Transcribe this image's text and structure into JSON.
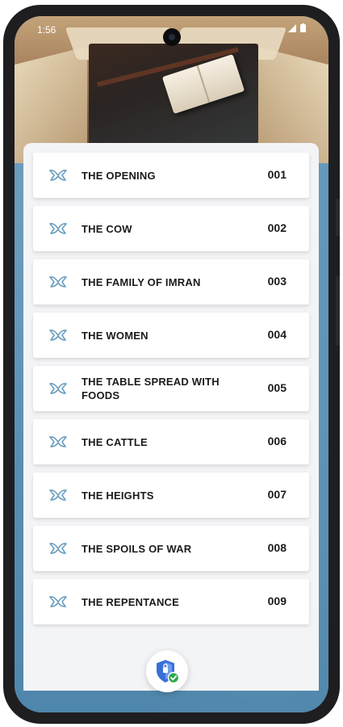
{
  "status_bar": {
    "time": "1:56",
    "icons": [
      "signal-icon",
      "battery-icon"
    ]
  },
  "chapters": [
    {
      "title": "THE OPENING",
      "number": "001"
    },
    {
      "title": "THE COW",
      "number": "002"
    },
    {
      "title": "THE FAMILY OF IMRAN",
      "number": "003"
    },
    {
      "title": "THE WOMEN",
      "number": "004"
    },
    {
      "title": "THE TABLE SPREAD WITH FOODS",
      "number": "005"
    },
    {
      "title": "THE CATTLE",
      "number": "006"
    },
    {
      "title": "THE HEIGHTS",
      "number": "007"
    },
    {
      "title": "THE SPOILS OF WAR",
      "number": "008"
    },
    {
      "title": "THE REPENTANCE",
      "number": "009"
    }
  ],
  "colors": {
    "accent_icon": "#6a9ec0",
    "background_water": "#5a8db0",
    "panel": "#f3f4f6",
    "shield": "#3a6fd8",
    "check": "#2fa84f"
  },
  "fab_icon": "shield-check-icon"
}
